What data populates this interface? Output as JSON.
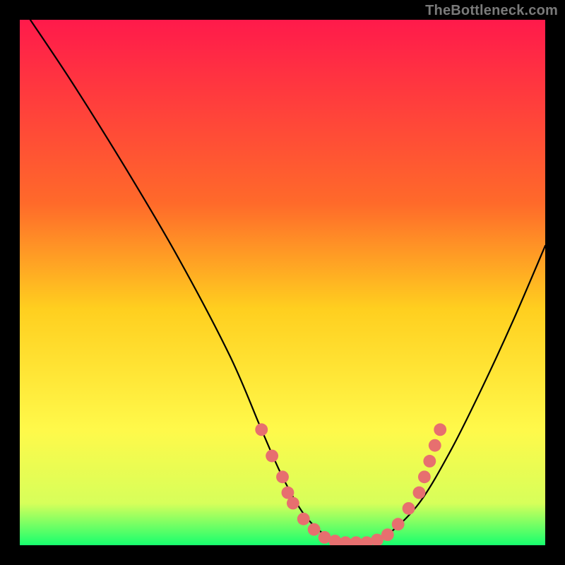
{
  "attribution": "TheBottleneck.com",
  "chart_data": {
    "type": "line",
    "title": "",
    "xlabel": "",
    "ylabel": "",
    "xlim": [
      0,
      100
    ],
    "ylim": [
      0,
      100
    ],
    "gradient_stops": [
      {
        "offset": 0,
        "color": "#ff1a4b"
      },
      {
        "offset": 35,
        "color": "#ff6a2a"
      },
      {
        "offset": 55,
        "color": "#ffcf1f"
      },
      {
        "offset": 78,
        "color": "#fff94a"
      },
      {
        "offset": 92,
        "color": "#d7ff5a"
      },
      {
        "offset": 100,
        "color": "#17ff6e"
      }
    ],
    "series": [
      {
        "name": "bottleneck-curve",
        "x": [
          2,
          10,
          20,
          30,
          40,
          46,
          50,
          54,
          58,
          62,
          66,
          70,
          76,
          82,
          88,
          94,
          100
        ],
        "y": [
          100,
          88,
          72,
          55,
          36,
          22,
          13,
          6,
          2,
          0,
          0,
          2,
          8,
          18,
          30,
          43,
          57
        ]
      }
    ],
    "scatter_points": {
      "name": "highlight-dots",
      "color": "#e76f6f",
      "radius": 1.2,
      "points": [
        {
          "x": 46,
          "y": 22
        },
        {
          "x": 48,
          "y": 17
        },
        {
          "x": 50,
          "y": 13
        },
        {
          "x": 51,
          "y": 10
        },
        {
          "x": 52,
          "y": 8
        },
        {
          "x": 54,
          "y": 5
        },
        {
          "x": 56,
          "y": 3
        },
        {
          "x": 58,
          "y": 1.5
        },
        {
          "x": 60,
          "y": 0.8
        },
        {
          "x": 62,
          "y": 0.5
        },
        {
          "x": 64,
          "y": 0.5
        },
        {
          "x": 66,
          "y": 0.5
        },
        {
          "x": 68,
          "y": 1
        },
        {
          "x": 70,
          "y": 2
        },
        {
          "x": 72,
          "y": 4
        },
        {
          "x": 74,
          "y": 7
        },
        {
          "x": 76,
          "y": 10
        },
        {
          "x": 77,
          "y": 13
        },
        {
          "x": 78,
          "y": 16
        },
        {
          "x": 79,
          "y": 19
        },
        {
          "x": 80,
          "y": 22
        }
      ]
    }
  }
}
